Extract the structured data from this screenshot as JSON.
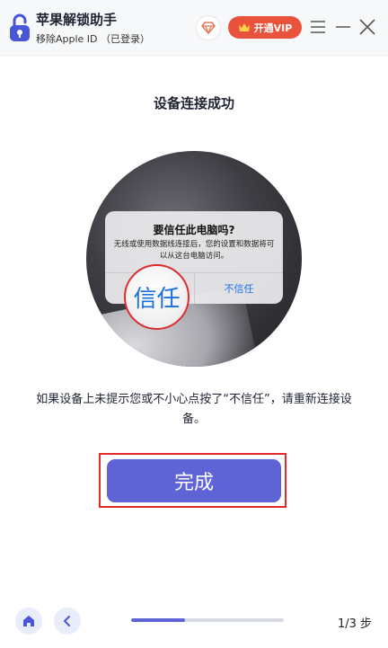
{
  "header": {
    "app_title": "苹果解锁助手",
    "subtitle": "移除Apple ID （已登录）",
    "vip_label": "开通VIP",
    "icons": [
      "lock-logo-icon",
      "diamond-icon",
      "crown-icon",
      "menu-icon",
      "minimize-icon",
      "close-icon"
    ]
  },
  "main": {
    "title": "设备连接成功",
    "dialog": {
      "title": "要信任此电脑吗?",
      "body": "无线或使用数据线连接后，您的设置和数据将可以从这台电脑访问。",
      "trust_label": "信任",
      "distrust_label": "不信任"
    },
    "hint": "如果设备上未提示您或不小心点按了“不信任”，请重新连接设备。",
    "finish_label": "完成"
  },
  "footer": {
    "step_label": "1/3 步",
    "progress": 0.35,
    "icons": [
      "home-icon",
      "chevron-left-icon"
    ]
  },
  "colors": {
    "accent": "#5e63d6",
    "vip": "#e9533b",
    "highlight": "#e02b2b",
    "link_blue": "#1a73e8"
  }
}
